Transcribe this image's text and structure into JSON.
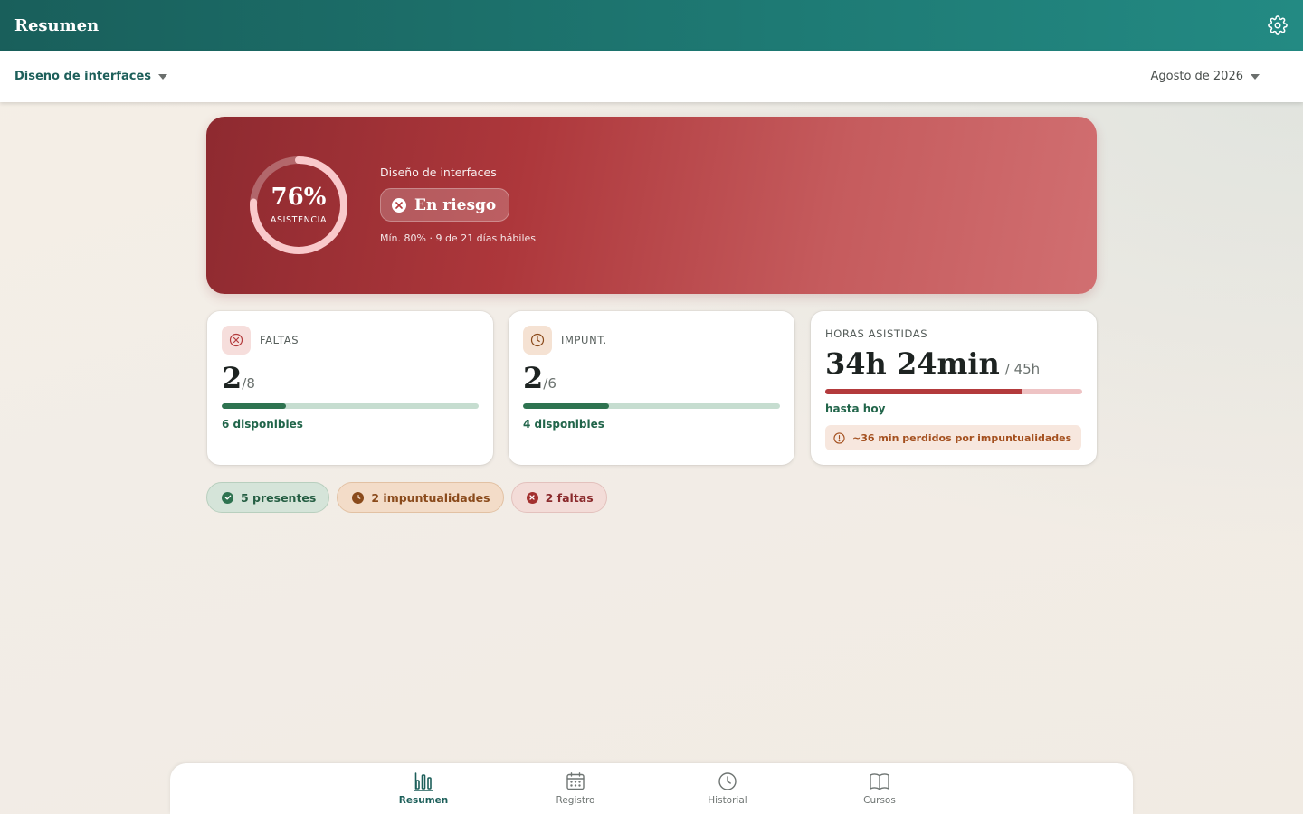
{
  "appbar": {
    "title": "Resumen",
    "settings_icon": "gear-icon"
  },
  "filters": {
    "course": "Diseño de interfaces",
    "month": "Agosto de 2026"
  },
  "hero": {
    "attendance_pct": "76%",
    "attendance_fraction": 0.76,
    "attendance_label": "ASISTENCIA",
    "course": "Diseño de interfaces",
    "status": "En riesgo",
    "meta": "Mín. 80% · 9 de 21 días hábiles"
  },
  "faltas": {
    "title": "FALTAS",
    "value": "2",
    "total": "/8",
    "fraction": 0.25,
    "available": "6 disponibles"
  },
  "impunt": {
    "title": "IMPUNT.",
    "value": "2",
    "total": "/6",
    "fraction": 0.333,
    "available": "4 disponibles"
  },
  "horas": {
    "title": "HORAS ASISTIDAS",
    "value": "34h 24min",
    "total": "/ 45h",
    "fraction": 0.764,
    "until": "hasta hoy",
    "lost": "~36 min perdidos por impuntualidades"
  },
  "chips": {
    "present": "5 presentes",
    "late": "2 impuntualidades",
    "absent": "2 faltas"
  },
  "nav": {
    "resumen": "Resumen",
    "registro": "Registro",
    "historial": "Historial",
    "cursos": "Cursos"
  },
  "colors": {
    "primary": "#1d5f5a",
    "danger": "#b33a3c",
    "warning": "#a4501f",
    "success": "#2e7350"
  }
}
